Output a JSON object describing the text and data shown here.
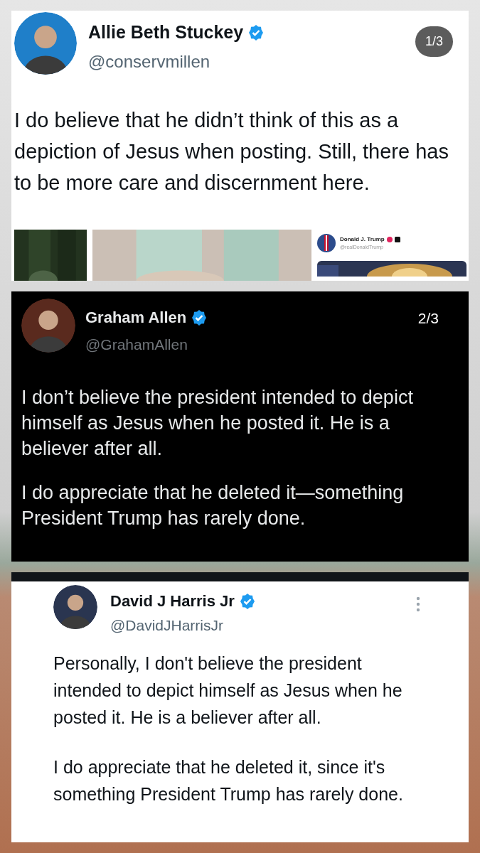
{
  "posts": [
    {
      "kind": "light",
      "author": "Allie Beth Stuckey",
      "verified": true,
      "handle": "@conservmillen",
      "counter": {
        "text": "1/3",
        "kind": "pill"
      },
      "paragraphs": [
        "I do believe that he didn’t think of this as a depiction of Jesus when posting. Still, there has to be more care and discernment here."
      ],
      "media": {
        "quoted_author": "Donald J. Trump",
        "quoted_handle": "@realDonaldTrump"
      }
    },
    {
      "kind": "dark",
      "author": "Graham Allen",
      "verified": true,
      "handle": "@GrahamAllen",
      "counter": {
        "text": "2/3",
        "kind": "plain"
      },
      "paragraphs": [
        "I don’t believe the president intended to depict himself as Jesus when he posted it. He is a believer after all.",
        "I do appreciate that he deleted it—something President Trump has rarely done."
      ]
    },
    {
      "kind": "framed",
      "author": "David J Harris Jr",
      "verified": true,
      "handle": "@DavidJHarrisJr",
      "paragraphs": [
        "Personally, I don't believe the president intended to depict himself as Jesus when he posted it. He is a believer after all.",
        "I do appreciate that he deleted it, since it's something President Trump has rarely done."
      ]
    }
  ]
}
